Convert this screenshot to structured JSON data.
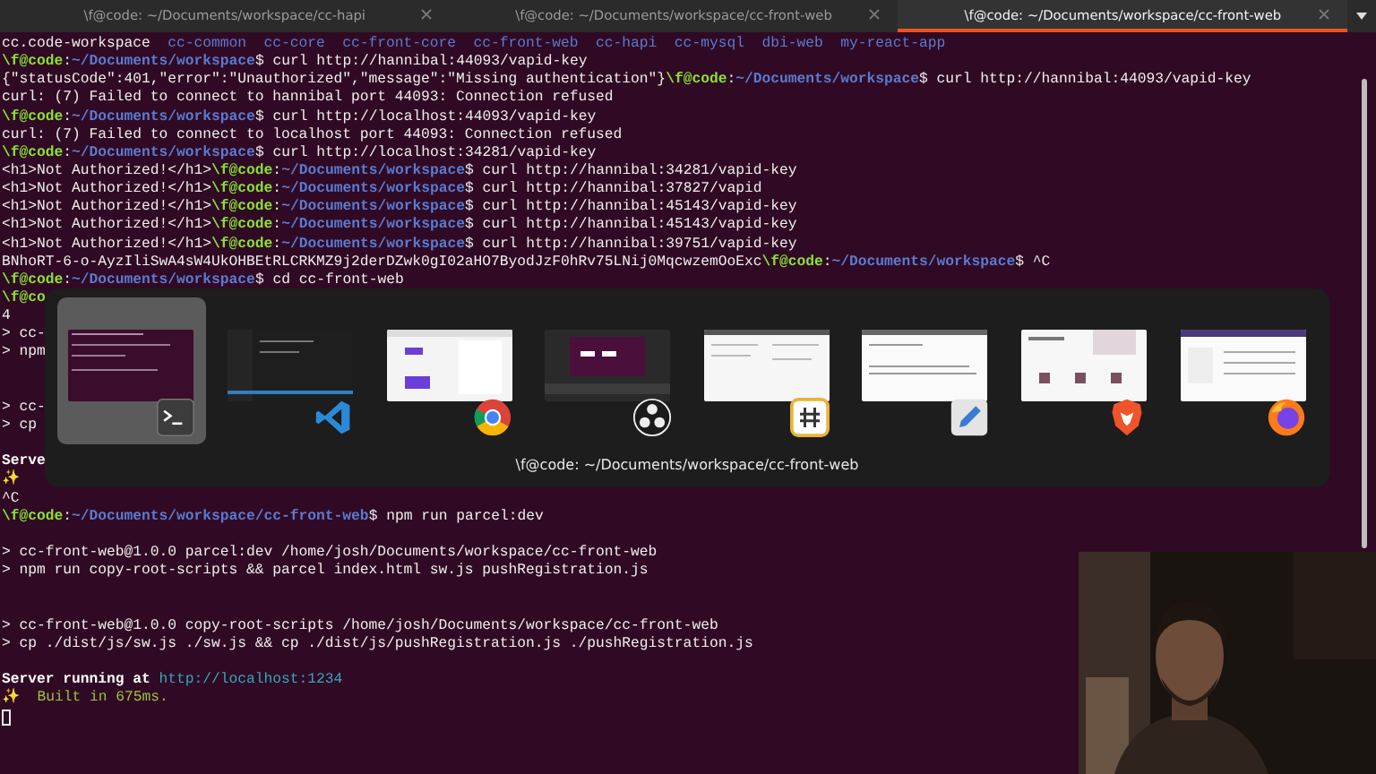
{
  "tabs": [
    {
      "title": "\\f@code: ~/Documents/workspace/cc-hapi",
      "selected": false
    },
    {
      "title": "\\f@code: ~/Documents/workspace/cc-front-web",
      "selected": false
    },
    {
      "title": "\\f@code: ~/Documents/workspace/cc-front-web",
      "selected": true
    }
  ],
  "terminal": {
    "lines": [
      {
        "kind": "text",
        "segments": [
          {
            "kind": "plain",
            "text": "cc.code-workspace  "
          },
          {
            "kind": "dir",
            "text": "cc-common  cc-core  cc-front-core  cc-front-web  cc-hapi  cc-mysql  dbi-web  my-react-app"
          }
        ]
      },
      {
        "kind": "text",
        "segments": [
          {
            "kind": "user",
            "text": "\\f@code"
          },
          {
            "kind": "plain",
            "text": ":"
          },
          {
            "kind": "path",
            "text": "~/Documents/workspace"
          },
          {
            "kind": "plain",
            "text": "$ curl http://hannibal:44093/vapid-key"
          }
        ]
      },
      {
        "kind": "text",
        "segments": [
          {
            "kind": "plain",
            "text": "{\"statusCode\":401,\"error\":\"Unauthorized\",\"message\":\"Missing authentication\"}"
          },
          {
            "kind": "user",
            "text": "\\f@code"
          },
          {
            "kind": "plain",
            "text": ":"
          },
          {
            "kind": "path",
            "text": "~/Documents/workspace"
          },
          {
            "kind": "plain",
            "text": "$ curl http://hannibal:44093/vapid-key"
          }
        ]
      },
      {
        "kind": "text",
        "segments": [
          {
            "kind": "plain",
            "text": "curl: (7) Failed to connect to hannibal port 44093: Connection refused"
          }
        ]
      },
      {
        "kind": "text",
        "segments": [
          {
            "kind": "user",
            "text": "\\f@code"
          },
          {
            "kind": "plain",
            "text": ":"
          },
          {
            "kind": "path",
            "text": "~/Documents/workspace"
          },
          {
            "kind": "plain",
            "text": "$ curl http://localhost:44093/vapid-key"
          }
        ]
      },
      {
        "kind": "text",
        "segments": [
          {
            "kind": "plain",
            "text": "curl: (7) Failed to connect to localhost port 44093: Connection refused"
          }
        ]
      },
      {
        "kind": "text",
        "segments": [
          {
            "kind": "user",
            "text": "\\f@code"
          },
          {
            "kind": "plain",
            "text": ":"
          },
          {
            "kind": "path",
            "text": "~/Documents/workspace"
          },
          {
            "kind": "plain",
            "text": "$ curl http://localhost:34281/vapid-key"
          }
        ]
      },
      {
        "kind": "text",
        "segments": [
          {
            "kind": "plain",
            "text": "<h1>Not Authorized!</h1>"
          },
          {
            "kind": "user",
            "text": "\\f@code"
          },
          {
            "kind": "plain",
            "text": ":"
          },
          {
            "kind": "path",
            "text": "~/Documents/workspace"
          },
          {
            "kind": "plain",
            "text": "$ curl http://hannibal:34281/vapid-key"
          }
        ]
      },
      {
        "kind": "text",
        "segments": [
          {
            "kind": "plain",
            "text": "<h1>Not Authorized!</h1>"
          },
          {
            "kind": "user",
            "text": "\\f@code"
          },
          {
            "kind": "plain",
            "text": ":"
          },
          {
            "kind": "path",
            "text": "~/Documents/workspace"
          },
          {
            "kind": "plain",
            "text": "$ curl http://hannibal:37827/vapid"
          }
        ]
      },
      {
        "kind": "text",
        "segments": [
          {
            "kind": "plain",
            "text": "<h1>Not Authorized!</h1>"
          },
          {
            "kind": "user",
            "text": "\\f@code"
          },
          {
            "kind": "plain",
            "text": ":"
          },
          {
            "kind": "path",
            "text": "~/Documents/workspace"
          },
          {
            "kind": "plain",
            "text": "$ curl http://hannibal:45143/vapid-key"
          }
        ]
      },
      {
        "kind": "text",
        "segments": [
          {
            "kind": "plain",
            "text": "<h1>Not Authorized!</h1>"
          },
          {
            "kind": "user",
            "text": "\\f@code"
          },
          {
            "kind": "plain",
            "text": ":"
          },
          {
            "kind": "path",
            "text": "~/Documents/workspace"
          },
          {
            "kind": "plain",
            "text": "$ curl http://hannibal:45143/vapid-key"
          }
        ]
      },
      {
        "kind": "text",
        "segments": [
          {
            "kind": "plain",
            "text": "<h1>Not Authorized!</h1>"
          },
          {
            "kind": "user",
            "text": "\\f@code"
          },
          {
            "kind": "plain",
            "text": ":"
          },
          {
            "kind": "path",
            "text": "~/Documents/workspace"
          },
          {
            "kind": "plain",
            "text": "$ curl http://hannibal:39751/vapid-key"
          }
        ]
      },
      {
        "kind": "text",
        "segments": [
          {
            "kind": "plain",
            "text": "BNhoRT-6-o-AyzIliSwA4sW4UkOHBEtRLCRKMZ9j2derDZwk0gI02aHO7ByodJzF0hRv75LNij0MqcwzemOoExc"
          },
          {
            "kind": "user",
            "text": "\\f@code"
          },
          {
            "kind": "plain",
            "text": ":"
          },
          {
            "kind": "path",
            "text": "~/Documents/workspace"
          },
          {
            "kind": "plain",
            "text": "$ ^C"
          }
        ]
      },
      {
        "kind": "text",
        "segments": [
          {
            "kind": "user",
            "text": "\\f@code"
          },
          {
            "kind": "plain",
            "text": ":"
          },
          {
            "kind": "path",
            "text": "~/Documents/workspace"
          },
          {
            "kind": "plain",
            "text": "$ cd cc-front-web"
          }
        ]
      },
      {
        "kind": "text",
        "segments": [
          {
            "kind": "user",
            "text": "\\f@co"
          }
        ]
      },
      {
        "kind": "text",
        "segments": [
          {
            "kind": "plain",
            "text": "4"
          }
        ]
      },
      {
        "kind": "text",
        "segments": [
          {
            "kind": "plain",
            "text": "> cc-"
          }
        ]
      },
      {
        "kind": "text",
        "segments": [
          {
            "kind": "plain",
            "text": "> npm"
          }
        ]
      },
      {
        "kind": "blank"
      },
      {
        "kind": "blank"
      },
      {
        "kind": "text",
        "segments": [
          {
            "kind": "plain",
            "text": "> cc-"
          }
        ]
      },
      {
        "kind": "text",
        "segments": [
          {
            "kind": "plain",
            "text": "> cp"
          }
        ]
      },
      {
        "kind": "blank"
      },
      {
        "kind": "text",
        "segments": [
          {
            "kind": "bold",
            "text": "Serve"
          }
        ]
      },
      {
        "kind": "text",
        "segments": [
          {
            "kind": "sparkle",
            "text": "✨"
          }
        ]
      },
      {
        "kind": "text",
        "segments": [
          {
            "kind": "plain",
            "text": "^C"
          }
        ]
      },
      {
        "kind": "text",
        "segments": [
          {
            "kind": "user",
            "text": "\\f@code"
          },
          {
            "kind": "plain",
            "text": ":"
          },
          {
            "kind": "path",
            "text": "~/Documents/workspace/cc-front-web"
          },
          {
            "kind": "plain",
            "text": "$ npm run parcel:dev"
          }
        ]
      },
      {
        "kind": "blank"
      },
      {
        "kind": "text",
        "segments": [
          {
            "kind": "plain",
            "text": "> cc-front-web@1.0.0 parcel:dev /home/josh/Documents/workspace/cc-front-web"
          }
        ]
      },
      {
        "kind": "text",
        "segments": [
          {
            "kind": "plain",
            "text": "> npm run copy-root-scripts && parcel index.html sw.js pushRegistration.js"
          }
        ]
      },
      {
        "kind": "blank"
      },
      {
        "kind": "blank"
      },
      {
        "kind": "text",
        "segments": [
          {
            "kind": "plain",
            "text": "> cc-front-web@1.0.0 copy-root-scripts /home/josh/Documents/workspace/cc-front-web"
          }
        ]
      },
      {
        "kind": "text",
        "segments": [
          {
            "kind": "plain",
            "text": "> cp ./dist/js/sw.js ./sw.js && cp ./dist/js/pushRegistration.js ./pushRegistration.js"
          }
        ]
      },
      {
        "kind": "blank"
      },
      {
        "kind": "text",
        "segments": [
          {
            "kind": "bold",
            "text": "Server running at "
          },
          {
            "kind": "link",
            "text": "http://localhost:1234"
          }
        ]
      },
      {
        "kind": "text",
        "segments": [
          {
            "kind": "sparkle",
            "text": "✨  "
          },
          {
            "kind": "success",
            "text": "Built in 675ms."
          }
        ]
      },
      {
        "kind": "cursor"
      }
    ]
  },
  "switcher": {
    "items": [
      {
        "kind": "terminal",
        "selected": true
      },
      {
        "kind": "vscode",
        "selected": false
      },
      {
        "kind": "chrome",
        "selected": false
      },
      {
        "kind": "obs",
        "selected": false
      },
      {
        "kind": "hashapp",
        "selected": false
      },
      {
        "kind": "texteditor",
        "selected": false
      },
      {
        "kind": "brave",
        "selected": false
      },
      {
        "kind": "firefox",
        "selected": false
      }
    ],
    "caption": "\\f@code: ~/Documents/workspace/cc-front-web"
  }
}
